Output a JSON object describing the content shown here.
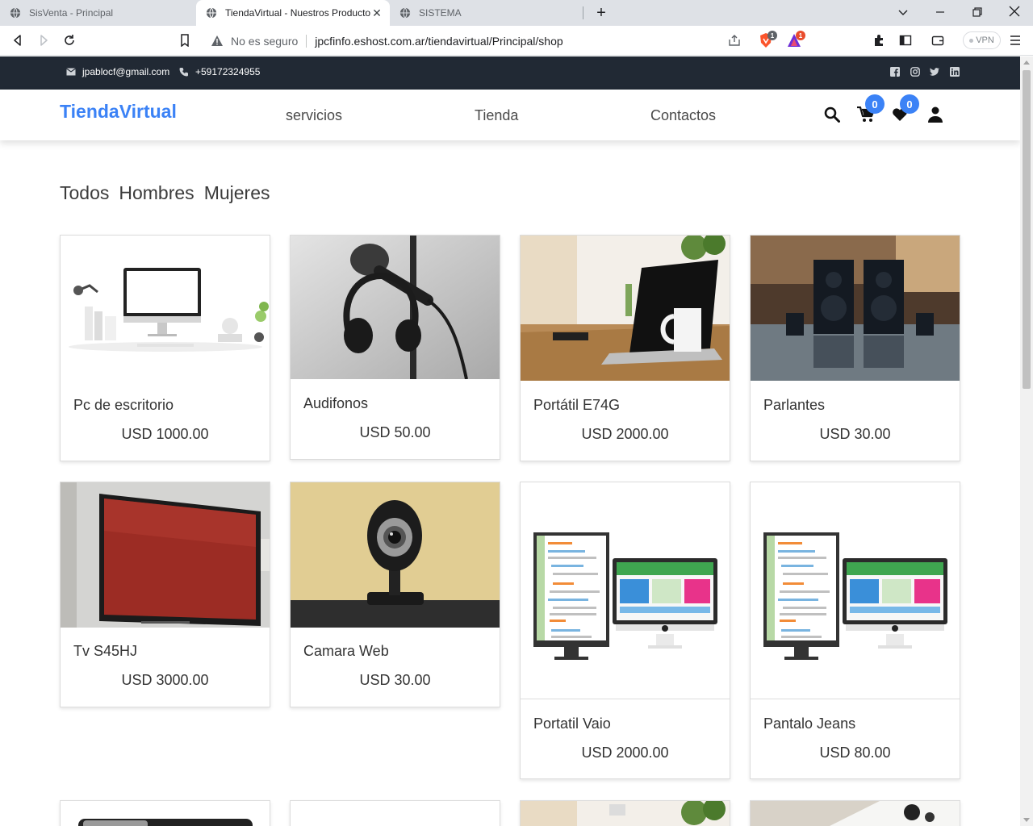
{
  "browser": {
    "tabs": [
      {
        "title": "SisVenta - Principal"
      },
      {
        "title": "TiendaVirtual - Nuestros Producto"
      },
      {
        "title": "SISTEMA"
      }
    ],
    "security_label": "No es seguro",
    "url": "jpcfinfo.eshost.com.ar/tiendavirtual/Principal/shop",
    "vpn_label": "VPN",
    "brave_badge": "1",
    "rewards_badge": "1"
  },
  "topbar": {
    "email": "jpablocf@gmail.com",
    "phone": "+59172324955",
    "social_icons": [
      "facebook-icon",
      "instagram-icon",
      "twitter-icon",
      "linkedin-icon"
    ]
  },
  "nav": {
    "brand": "TiendaVirtual",
    "links": [
      "servicios",
      "Tienda",
      "Contactos"
    ],
    "cart_count": "0",
    "wishlist_count": "0"
  },
  "filters": [
    "Todos",
    "Hombres",
    "Mujeres"
  ],
  "products": [
    {
      "name": "Pc de escritorio",
      "price": "USD 1000.00",
      "image": "desktop-pc"
    },
    {
      "name": "Audifonos",
      "price": "USD 50.00",
      "image": "headphones"
    },
    {
      "name": "Portátil E74G",
      "price": "USD 2000.00",
      "image": "laptop"
    },
    {
      "name": "Parlantes",
      "price": "USD 30.00",
      "image": "speakers"
    },
    {
      "name": "Tv S45HJ",
      "price": "USD 3000.00",
      "image": "tv"
    },
    {
      "name": "Camara Web",
      "price": "USD 30.00",
      "image": "webcam"
    },
    {
      "name": "Portatil Vaio",
      "price": "USD 2000.00",
      "image": "monitors-illustration"
    },
    {
      "name": "Pantalo Jeans",
      "price": "USD 80.00",
      "image": "monitors-illustration"
    }
  ],
  "colors": {
    "brand": "#3b82f6",
    "topbar": "#212934",
    "text": "#333333"
  }
}
